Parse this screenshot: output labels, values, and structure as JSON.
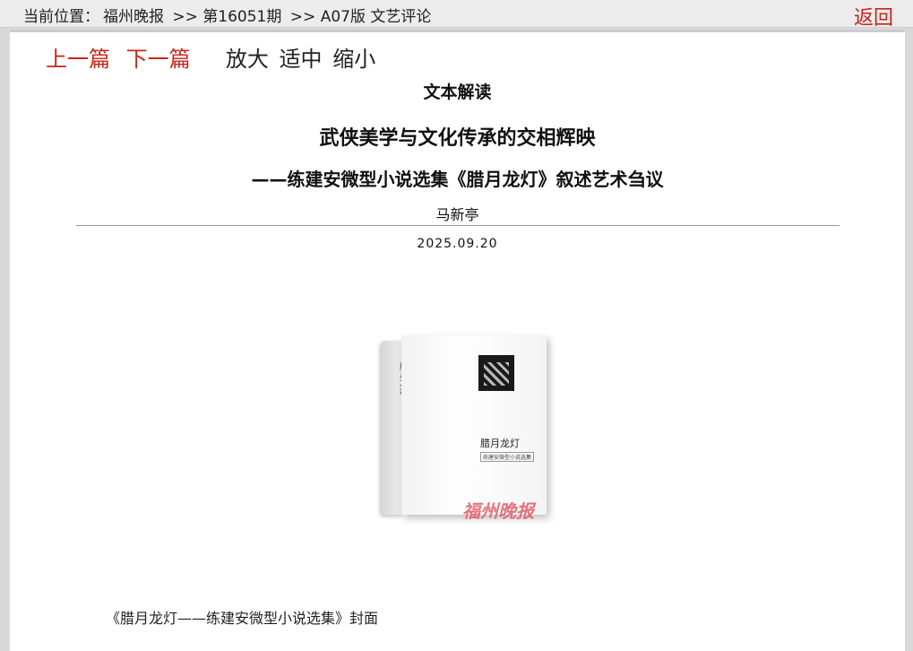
{
  "header": {
    "location_label": "当前位置：",
    "crumbs": [
      "福州晚报",
      ">> 第16051期",
      ">> A07版 文艺评论"
    ],
    "back_label": "返回"
  },
  "nav": {
    "prev": "上一篇",
    "next": "下一篇",
    "zoom_in": "放大",
    "fit": "适中",
    "zoom_out": "缩小"
  },
  "article": {
    "column": "文本解读",
    "title": "武侠美学与文化传承的交相辉映",
    "subtitle": "——练建安微型小说选集《腊月龙灯》叙述艺术刍议",
    "author": "马新亭",
    "date": "2025.09.20",
    "image": {
      "spine_text": "腊月龙灯",
      "cover_title": "腊月龙灯",
      "cover_subtitle": "练建安微型小说选集",
      "watermark": "福州晚报"
    },
    "caption": "《腊月龙灯——练建安微型小说选集》封面"
  },
  "colors": {
    "accent": "#c8241b",
    "text": "#222222",
    "background": "#d9d9d9"
  }
}
